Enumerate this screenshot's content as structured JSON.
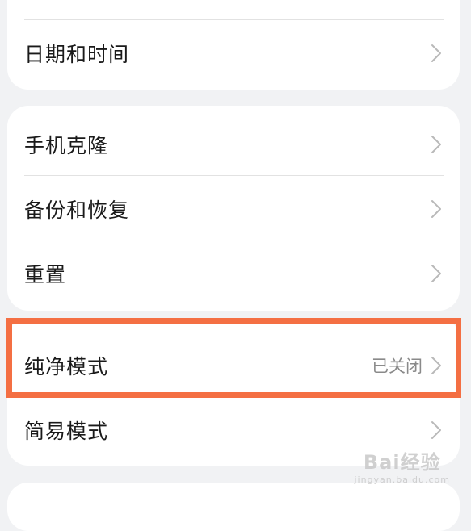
{
  "settings": {
    "group1": {
      "date_time": "日期和时间"
    },
    "group2": {
      "phone_clone": "手机克隆",
      "backup_restore": "备份和恢复",
      "reset": "重置"
    },
    "group3": {
      "pure_mode": "纯净模式",
      "pure_mode_status": "已关闭",
      "simple_mode": "简易模式"
    }
  },
  "colors": {
    "highlight": "#f46f43",
    "background": "#f1f2f4"
  },
  "icons": {
    "row_chevron": "chevron-right-icon"
  },
  "watermark": {
    "brand": "Bai经验",
    "url": "jingyan.baidu.com"
  }
}
